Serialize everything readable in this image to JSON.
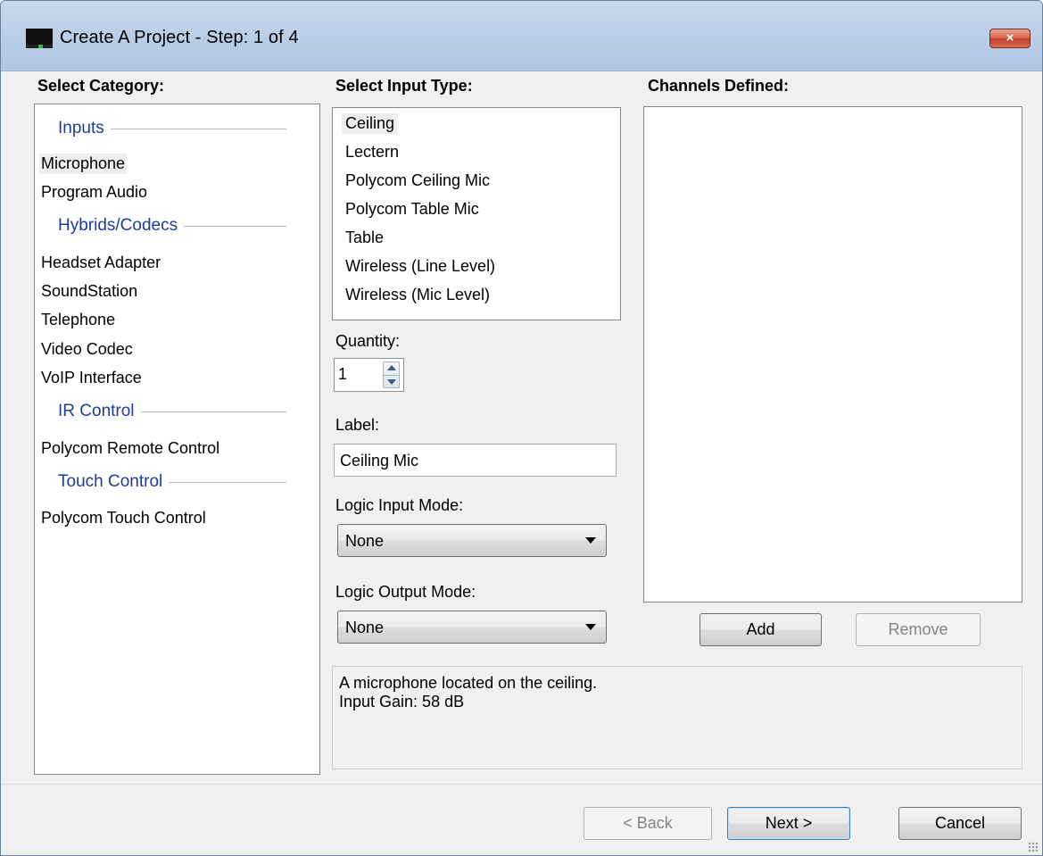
{
  "window": {
    "title": "Create A Project - Step: 1 of 4",
    "close_icon": "×"
  },
  "category": {
    "header": "Select Category:",
    "groups": [
      {
        "title": "Inputs",
        "items": [
          "Microphone",
          "Program Audio"
        ]
      },
      {
        "title": "Hybrids/Codecs",
        "items": [
          "Headset Adapter",
          "SoundStation",
          "Telephone",
          "Video Codec",
          "VoIP Interface"
        ]
      },
      {
        "title": "IR Control",
        "items": [
          "Polycom Remote Control"
        ]
      },
      {
        "title": "Touch Control",
        "items": [
          "Polycom Touch Control"
        ]
      }
    ],
    "selected": "Microphone"
  },
  "input_type": {
    "header": "Select Input Type:",
    "items": [
      "Ceiling",
      "Lectern",
      "Polycom Ceiling Mic",
      "Polycom Table Mic",
      "Table",
      "Wireless (Line Level)",
      "Wireless (Mic Level)"
    ],
    "selected": "Ceiling"
  },
  "quantity": {
    "label": "Quantity:",
    "value": "1"
  },
  "label_field": {
    "label": "Label:",
    "value": "Ceiling Mic"
  },
  "logic_input": {
    "label": "Logic Input Mode:",
    "value": "None"
  },
  "logic_output": {
    "label": "Logic Output Mode:",
    "value": "None"
  },
  "channels": {
    "header": "Channels Defined:",
    "add_label": "Add",
    "remove_label": "Remove"
  },
  "description": {
    "line1": "A microphone located on the ceiling.",
    "line2": "Input Gain: 58 dB"
  },
  "footer": {
    "back_label": "< Back",
    "next_label": "Next >",
    "cancel_label": "Cancel"
  },
  "icons": {
    "app": "monitor-icon",
    "close": "close-icon",
    "spinner_up": "arrow-up-icon",
    "spinner_down": "arrow-down-icon",
    "combo": "chevron-down-icon",
    "grip": "resize-grip-icon"
  },
  "colors": {
    "group_header": "#1e3c9b",
    "titlebar": "#bcd0e8",
    "close_button": "#c2402a",
    "default_button_border": "#3c7fb1"
  }
}
